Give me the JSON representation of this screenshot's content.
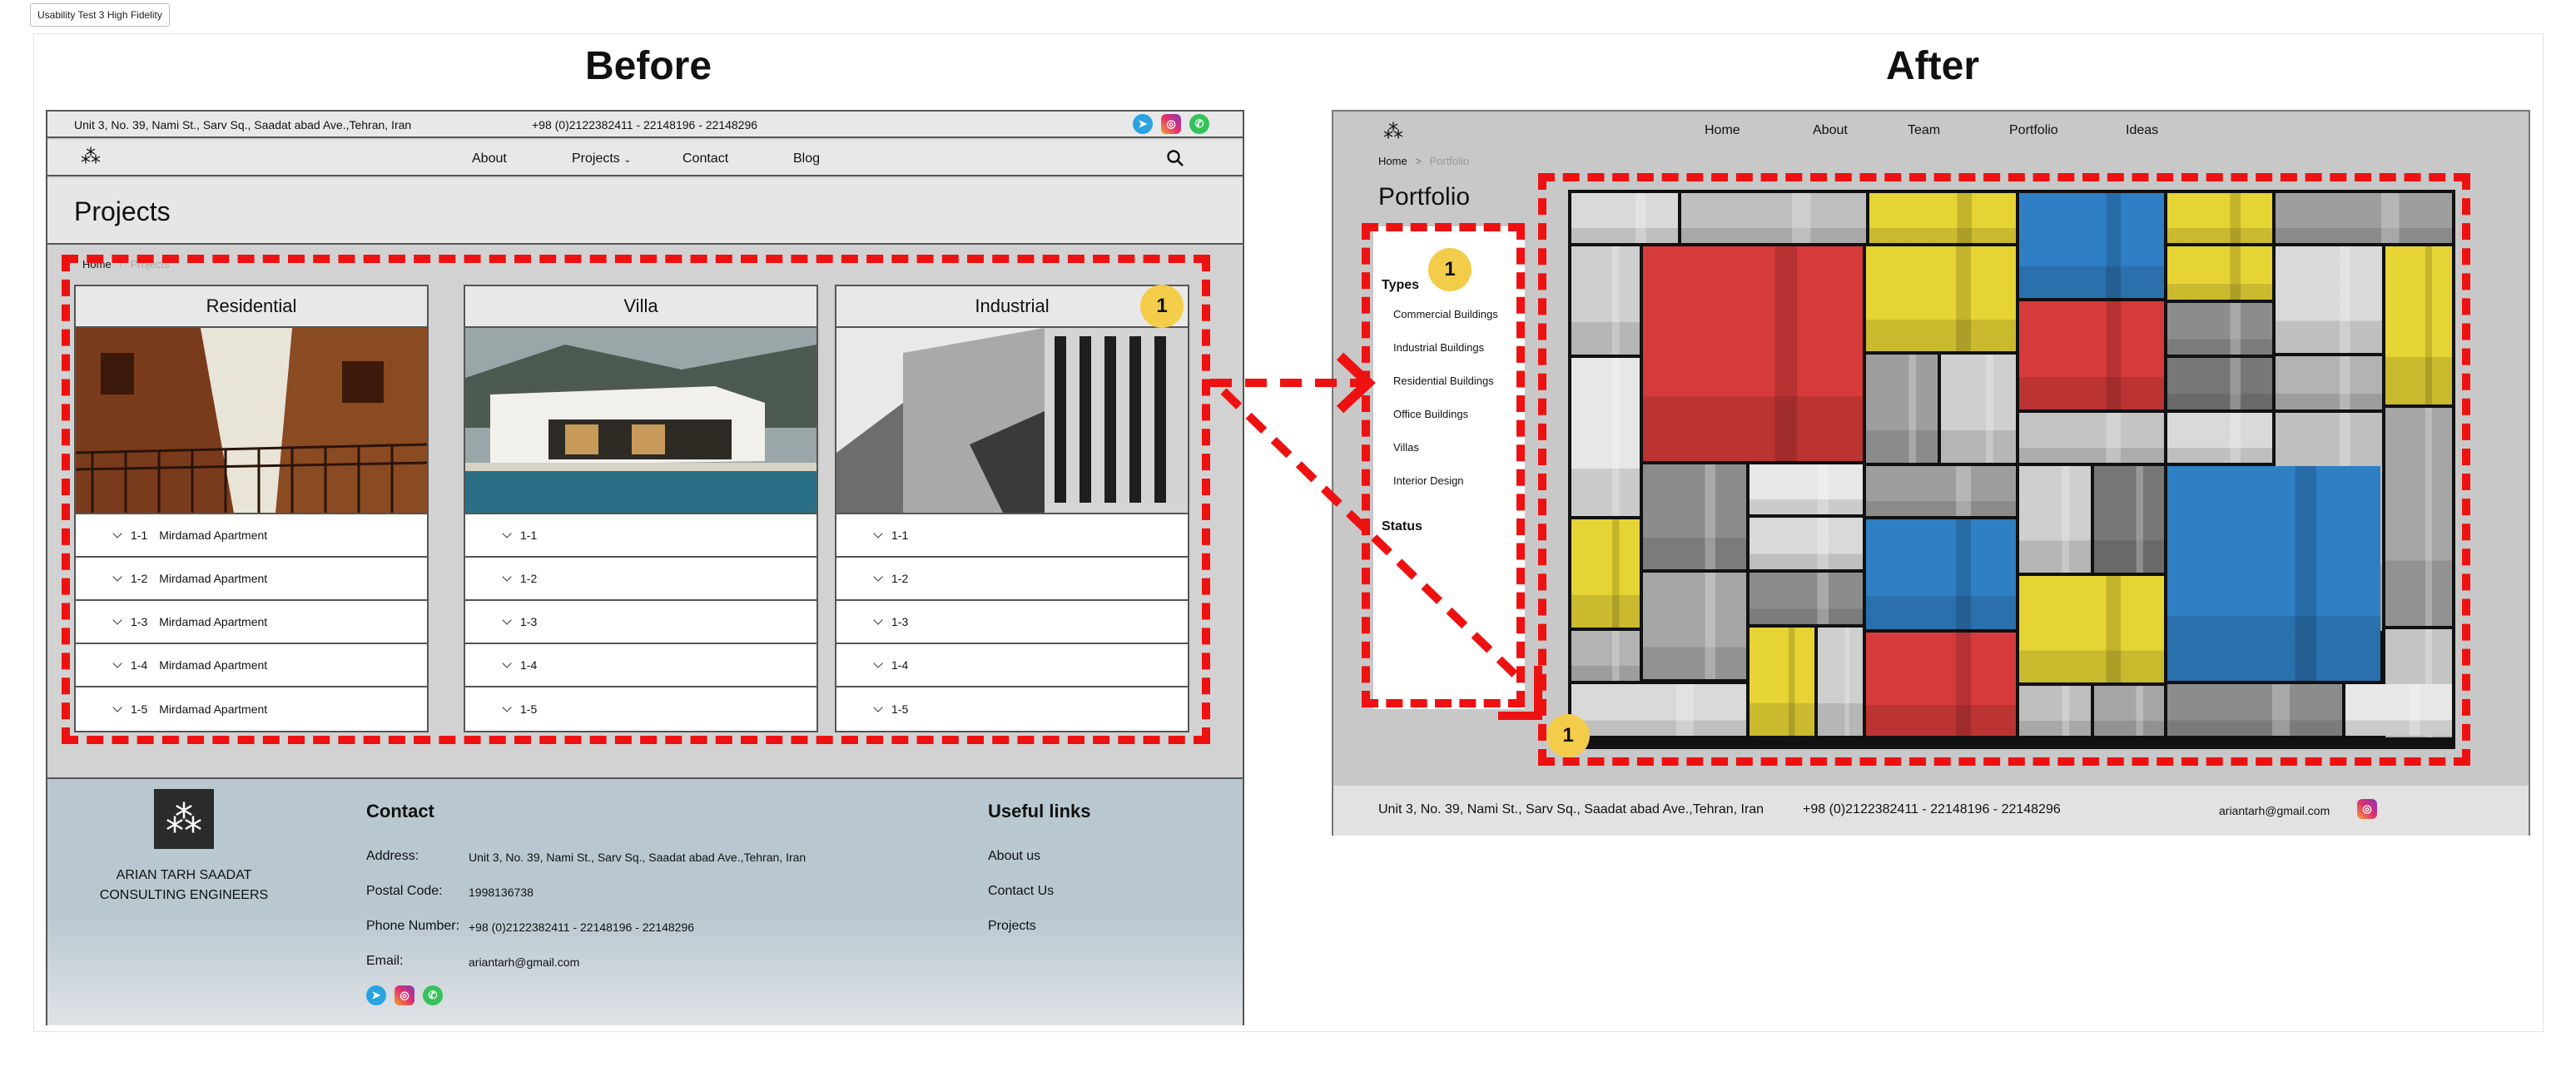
{
  "frame_label": "Usability Test 3 High Fidelity",
  "before": {
    "heading": "Before",
    "topbar": {
      "address": "Unit 3, No. 39, Nami St., Sarv Sq., Saadat abad Ave.,Tehran, Iran",
      "phone": "+98 (0)2122382411 - 22148196 - 22148296",
      "social_icons": [
        "telegram-icon",
        "instagram-icon",
        "whatsapp-icon"
      ]
    },
    "nav": {
      "items": [
        "About",
        "Projects",
        "Contact",
        "Blog"
      ],
      "search_icon": "search-icon"
    },
    "page_title": "Projects",
    "breadcrumb": {
      "home": "Home",
      "separator": "/",
      "current": "Projects"
    },
    "cards": [
      {
        "title": "Residential",
        "rows": [
          {
            "code": "1-1",
            "name": "Mirdamad Apartment"
          },
          {
            "code": "1-2",
            "name": "Mirdamad Apartment"
          },
          {
            "code": "1-3",
            "name": "Mirdamad Apartment"
          },
          {
            "code": "1-4",
            "name": "Mirdamad Apartment"
          },
          {
            "code": "1-5",
            "name": "Mirdamad Apartment"
          }
        ]
      },
      {
        "title": "Villa",
        "rows": [
          {
            "code": "1-1",
            "name": ""
          },
          {
            "code": "1-2",
            "name": ""
          },
          {
            "code": "1-3",
            "name": ""
          },
          {
            "code": "1-4",
            "name": ""
          },
          {
            "code": "1-5",
            "name": ""
          }
        ]
      },
      {
        "title": "Industrial",
        "rows": [
          {
            "code": "1-1",
            "name": ""
          },
          {
            "code": "1-2",
            "name": ""
          },
          {
            "code": "1-3",
            "name": ""
          },
          {
            "code": "1-4",
            "name": ""
          },
          {
            "code": "1-5",
            "name": ""
          }
        ]
      }
    ],
    "footer": {
      "firm_line1": "ARIAN TARH SAADAT",
      "firm_line2": "CONSULTING ENGINEERS",
      "contact_heading": "Contact",
      "address_label": "Address:",
      "address_value": "Unit 3, No. 39, Nami St., Sarv Sq., Saadat abad Ave.,Tehran, Iran",
      "postal_label": "Postal Code:",
      "postal_value": "1998136738",
      "phone_label": "Phone Number:",
      "phone_value": "+98 (0)2122382411 - 22148196 - 22148296",
      "email_label": "Email:",
      "email_value": "ariantarh@gmail.com",
      "links_heading": "Useful links",
      "links": [
        "About us",
        "Contact Us",
        "Projects"
      ]
    }
  },
  "after": {
    "heading": "After",
    "nav": {
      "items": [
        "Home",
        "About",
        "Team",
        "Portfolio",
        "Ideas"
      ]
    },
    "breadcrumb": {
      "home": "Home",
      "separator": ">",
      "current": "Portfolio"
    },
    "page_title": "Portfolio",
    "sidebar": {
      "types_heading": "Types",
      "types": [
        "Commercial Buildings",
        "Industrial Buildings",
        "Residential Buildings",
        "Office Buildings",
        "Villas",
        "Interior Design"
      ],
      "status_heading": "Status"
    },
    "footer": {
      "address": "Unit 3, No. 39, Nami St., Sarv Sq., Saadat abad Ave.,Tehran, Iran",
      "phone": "+98 (0)2122382411 - 22148196 - 22148296",
      "email": "ariantarh@gmail.com"
    },
    "highlight_colors": {
      "red": "#d63a3a",
      "yellow": "#e6d334",
      "blue": "#2f7fc4"
    }
  },
  "annotation_badge": "1",
  "annotation_color": "#ee1111"
}
